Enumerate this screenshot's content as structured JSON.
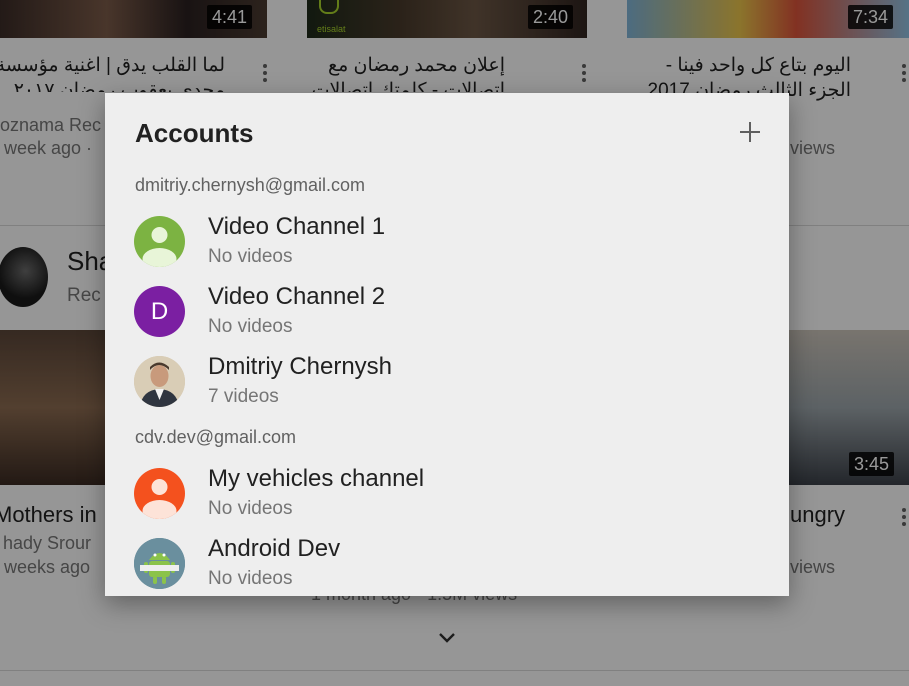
{
  "background": {
    "videos_top": [
      {
        "duration": "4:41",
        "title_line1": "لما القلب يدق | اغنية مؤسسة",
        "title_line2": "مجدي يعقوب رمضان ٢٠١٧",
        "channel": "oznama Rec",
        "age": "week ago ·"
      },
      {
        "duration": "2:40",
        "brand": "etisalat",
        "title_line1": "إعلان محمد رمضان مع",
        "title_line2": "اتصالات - كلمتك اتصالات"
      },
      {
        "duration": "7:34",
        "title_line1": "اليوم بتاع كل واحد فينا -",
        "title_line2": "الجزء الثالث رمضان 2017",
        "views": "views"
      }
    ],
    "shelf": {
      "title": "Sha",
      "subtitle": "Rec"
    },
    "videos_bottom": [
      {
        "title": "Mothers in",
        "channel": "hady Srour",
        "age": "weeks ago"
      },
      {
        "meta": "1 month ago · 1.5M views"
      },
      {
        "duration": "3:45",
        "title": "ungry",
        "views": "views"
      }
    ]
  },
  "dialog": {
    "title": "Accounts",
    "add_icon": "plus-icon",
    "groups": [
      {
        "email": "dmitriy.chernysh@gmail.com",
        "accounts": [
          {
            "name": "Video Channel 1",
            "subtitle": "No videos",
            "avatar": "person-icon",
            "avatar_color": "#7cb342"
          },
          {
            "name": "Video Channel 2",
            "subtitle": "No videos",
            "avatar_letter": "D",
            "avatar_color": "#7b1fa2"
          },
          {
            "name": "Dmitriy Chernysh",
            "subtitle": "7 videos",
            "avatar": "photo"
          }
        ]
      },
      {
        "email": "cdv.dev@gmail.com",
        "accounts": [
          {
            "name": "My vehicles channel",
            "subtitle": "No videos",
            "avatar": "person-icon",
            "avatar_color": "#f4511e"
          },
          {
            "name": "Android Dev",
            "subtitle": "No videos",
            "avatar": "android-icon",
            "avatar_color": "#5a7f8f"
          }
        ]
      }
    ]
  }
}
